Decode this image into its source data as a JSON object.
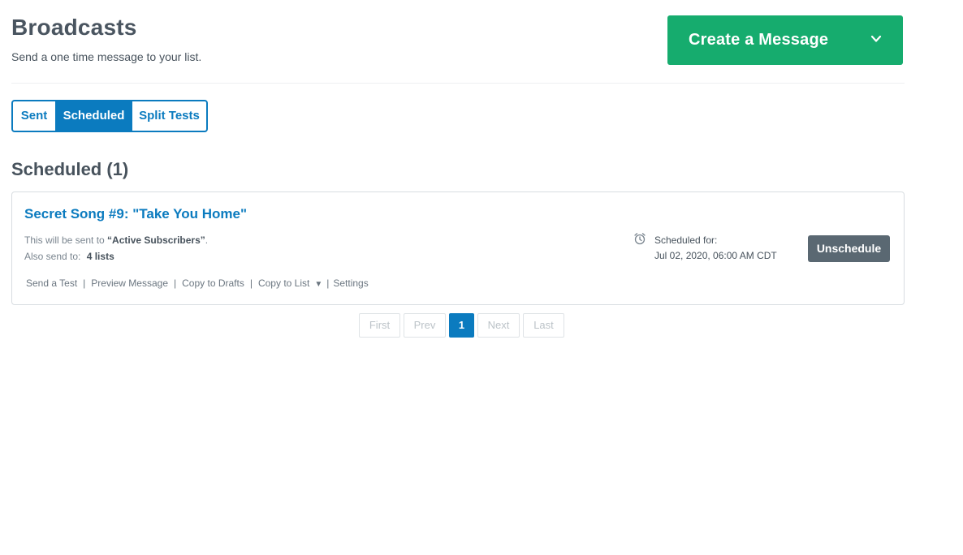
{
  "header": {
    "title": "Broadcasts",
    "subtitle": "Send a one time message to your list.",
    "create_button_label": "Create a Message"
  },
  "tabs": [
    {
      "label": "Sent",
      "active": false
    },
    {
      "label": "Scheduled",
      "active": true
    },
    {
      "label": "Split Tests",
      "active": false
    }
  ],
  "section": {
    "title": "Scheduled (1)"
  },
  "broadcast": {
    "title": "Secret Song #9: \"Take You Home\"",
    "send_prefix": "This will be sent to ",
    "audience": "“Active Subscribers”",
    "send_suffix": ".",
    "also_send_label": "Also send to:",
    "also_send_lists": "4 lists",
    "scheduled_label": "Scheduled for:",
    "scheduled_date": "Jul 02, 2020, 06:00 AM CDT",
    "unschedule_label": "Unschedule",
    "actions": {
      "send_test": "Send a Test",
      "preview": "Preview Message",
      "copy_drafts": "Copy to Drafts",
      "copy_list": "Copy to List",
      "settings": "Settings",
      "separator": "|"
    }
  },
  "pagination": {
    "first": "First",
    "prev": "Prev",
    "current": "1",
    "next": "Next",
    "last": "Last"
  },
  "colors": {
    "primary_blue": "#0b7bbf",
    "create_green": "#16ac6e",
    "unschedule_gray": "#5a6872"
  },
  "icons": {
    "create_chevron": "chevron-down-icon",
    "schedule": "alarm-clock-icon",
    "copy_list_caret": "caret-down-icon"
  }
}
